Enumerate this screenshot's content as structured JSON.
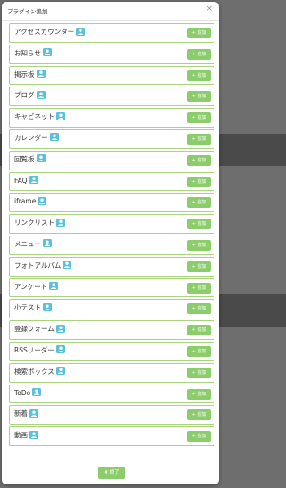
{
  "dialog": {
    "title": "プラグイン追加",
    "close_glyph": "×"
  },
  "plugins": [
    {
      "name": "アクセスカウンター",
      "add_label": "+ 追加"
    },
    {
      "name": "お知らせ",
      "add_label": "+ 追加"
    },
    {
      "name": "掲示板",
      "add_label": "+ 追加"
    },
    {
      "name": "ブログ",
      "add_label": "+ 追加"
    },
    {
      "name": "キャビネット",
      "add_label": "+ 追加"
    },
    {
      "name": "カレンダー",
      "add_label": "+ 追加"
    },
    {
      "name": "回覧板",
      "add_label": "+ 追加"
    },
    {
      "name": "FAQ",
      "add_label": "+ 追加"
    },
    {
      "name": "iframe",
      "add_label": "+ 追加"
    },
    {
      "name": "リンクリスト",
      "add_label": "+ 追加"
    },
    {
      "name": "メニュー",
      "add_label": "+ 追加"
    },
    {
      "name": "フォトアルバム",
      "add_label": "+ 追加"
    },
    {
      "name": "アンケート",
      "add_label": "+ 追加"
    },
    {
      "name": "小テスト",
      "add_label": "+ 追加"
    },
    {
      "name": "登録フォーム",
      "add_label": "+ 追加"
    },
    {
      "name": "RSSリーダー",
      "add_label": "+ 追加"
    },
    {
      "name": "検索ボックス",
      "add_label": "+ 追加"
    },
    {
      "name": "ToDo",
      "add_label": "+ 追加"
    },
    {
      "name": "新着",
      "add_label": "+ 追加"
    },
    {
      "name": "動画",
      "add_label": "+ 追加"
    }
  ],
  "footer": {
    "finish_label": "✖ 終了"
  },
  "colors": {
    "row_border": "#a9d47c",
    "add_button": "#8ccd6b",
    "user_icon": "#5bc0de",
    "backdrop": "#6e6e6e"
  },
  "icons": {
    "role": "user-icon",
    "close": "close-icon",
    "add": "plus-icon"
  }
}
